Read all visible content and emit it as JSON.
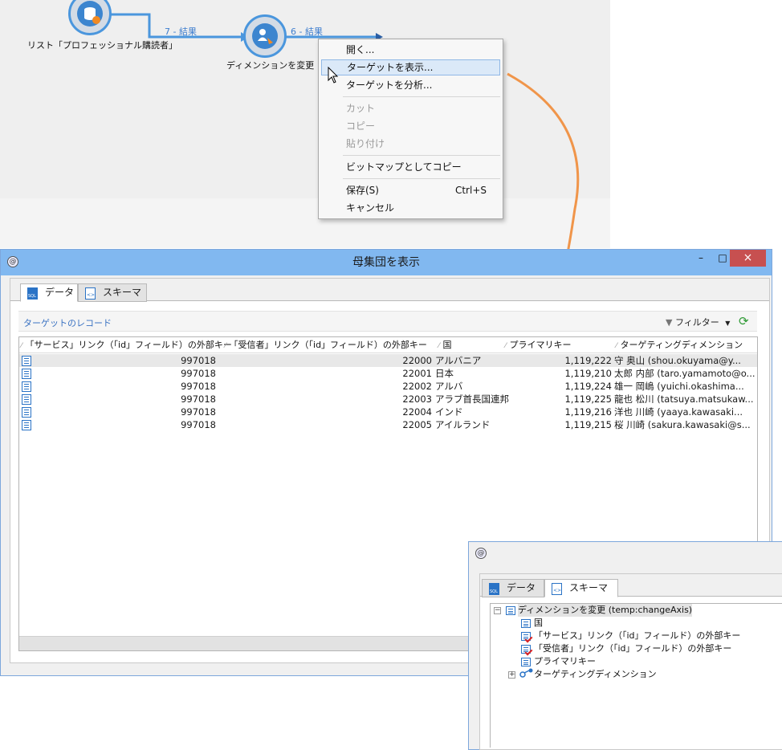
{
  "workflow": {
    "node1_label": "リスト「プロフェッショナル購読者」",
    "node2_label": "ディメンションを変更",
    "transition1": "7 - 結果",
    "transition2": "6 - 結果"
  },
  "context_menu": {
    "items": [
      {
        "label": "開く..."
      },
      {
        "label": "ターゲットを表示..."
      },
      {
        "label": "ターゲットを分析..."
      },
      {
        "label": "カット"
      },
      {
        "label": "コピー"
      },
      {
        "label": "貼り付け"
      },
      {
        "label": "ビットマップとしてコピー"
      },
      {
        "label": "保存(S)",
        "shortcut": "Ctrl+S"
      },
      {
        "label": "キャンセル"
      }
    ]
  },
  "window": {
    "title": "母集団を表示",
    "minimize": "–",
    "maximize": "□",
    "close": "×",
    "tabs": [
      {
        "label": "データ"
      },
      {
        "label": "スキーマ"
      }
    ],
    "records_label": "ターゲットのレコード",
    "filter_label": "フィルター",
    "columns": [
      "「サービス」リンク（「id」フィールド）の外部キー",
      "「受信者」リンク（「id」フィールド）の外部キー",
      "国",
      "プライマリキー",
      "ターゲティングディメンション"
    ],
    "rows": [
      {
        "service_fk": "997018",
        "recipient_fk": "22000",
        "country": "アルバニア",
        "pk": "1,119,222",
        "target": "守 奥山 (shou.okuyama@y..."
      },
      {
        "service_fk": "997018",
        "recipient_fk": "22001",
        "country": "日本",
        "pk": "1,119,210",
        "target": "太郎 内部 (taro.yamamoto@o..."
      },
      {
        "service_fk": "997018",
        "recipient_fk": "22002",
        "country": "アルバ",
        "pk": "1,119,224",
        "target": "雄一 岡嶋 (yuichi.okashima..."
      },
      {
        "service_fk": "997018",
        "recipient_fk": "22003",
        "country": "アラブ首長国連邦",
        "pk": "1,119,225",
        "target": "龍也 松川 (tatsuya.matsukaw..."
      },
      {
        "service_fk": "997018",
        "recipient_fk": "22004",
        "country": "インド",
        "pk": "1,119,216",
        "target": "洋也 川崎 (yaaya.kawasaki..."
      },
      {
        "service_fk": "997018",
        "recipient_fk": "22005",
        "country": "アイルランド",
        "pk": "1,119,215",
        "target": "桜 川崎 (sakura.kawasaki@s..."
      }
    ]
  },
  "schema_window": {
    "tabs": [
      {
        "label": "データ"
      },
      {
        "label": "スキーマ"
      }
    ],
    "tree": {
      "root": "ディメンションを変更 (temp:changeAxis)",
      "children": [
        "国",
        "「サービス」リンク（「id」フィールド）の外部キー",
        "「受信者」リンク（「id」フィールド）の外部キー",
        "プライマリキー",
        "ターゲティングディメンション"
      ]
    }
  },
  "colors": {
    "accent": "#4a96dd",
    "titlebar": "#81b8f0",
    "arrow": "#f0954a",
    "link": "#3a72c2",
    "close": "#c75050"
  }
}
